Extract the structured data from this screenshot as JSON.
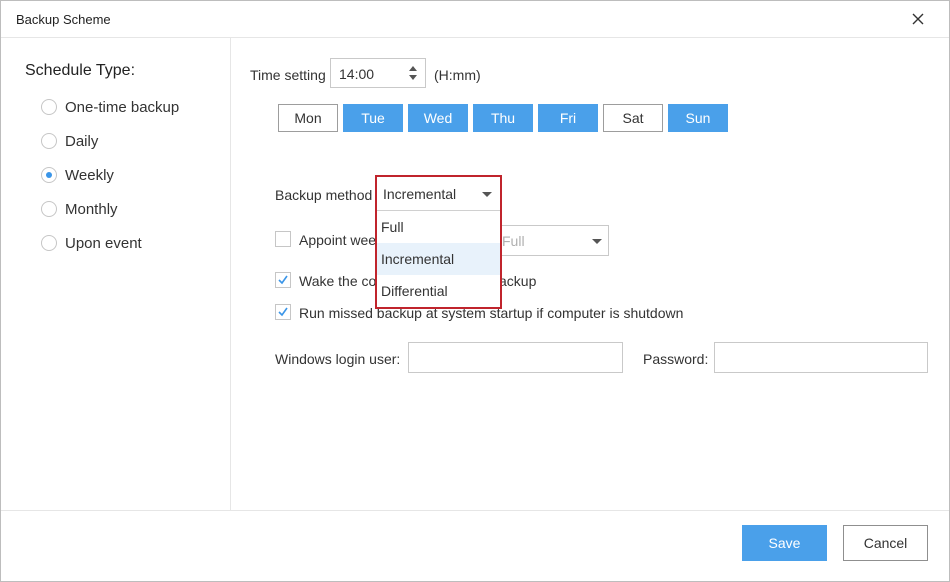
{
  "window": {
    "title": "Backup Scheme"
  },
  "schedule": {
    "heading": "Schedule Type:",
    "options": [
      {
        "label": "One-time backup",
        "selected": false
      },
      {
        "label": "Daily",
        "selected": false
      },
      {
        "label": "Weekly",
        "selected": true
      },
      {
        "label": "Monthly",
        "selected": false
      },
      {
        "label": "Upon event",
        "selected": false
      }
    ]
  },
  "time": {
    "label": "Time setting",
    "value": "14:00",
    "format": "(H:mm)"
  },
  "days": [
    {
      "label": "Mon",
      "selected": false
    },
    {
      "label": "Tue",
      "selected": true
    },
    {
      "label": "Wed",
      "selected": true
    },
    {
      "label": "Thu",
      "selected": true
    },
    {
      "label": "Fri",
      "selected": true
    },
    {
      "label": "Sat",
      "selected": false
    },
    {
      "label": "Sun",
      "selected": true
    }
  ],
  "backup_method": {
    "label": "Backup method",
    "value": "Incremental",
    "options": [
      "Full",
      "Incremental",
      "Differential"
    ],
    "highlighted": "Incremental"
  },
  "appoint": {
    "label_prefix": "Appoint wee",
    "checked": false,
    "select_value": "Full"
  },
  "wake": {
    "label_start": "Wake the co",
    "label_end": "ackup",
    "checked": true
  },
  "missed": {
    "label": "Run missed backup at system startup if computer is shutdown",
    "checked": true
  },
  "login": {
    "user_label": "Windows login user:",
    "user_value": "",
    "password_label": "Password:",
    "password_value": ""
  },
  "footer": {
    "save": "Save",
    "cancel": "Cancel"
  },
  "colors": {
    "accent": "#4aa0ea",
    "highlight_border": "#c0242c"
  }
}
